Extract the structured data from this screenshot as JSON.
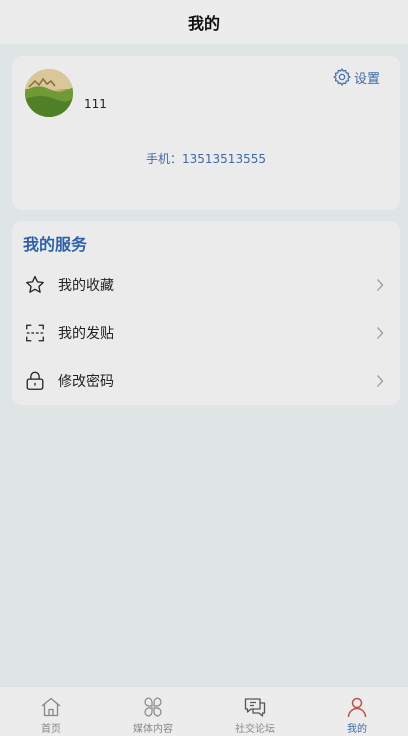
{
  "header": {
    "title": "我的"
  },
  "profile": {
    "username": "111",
    "settings_label": "设置",
    "settings_icon": "gear-icon",
    "phone_text": "手机：13513513555"
  },
  "services": {
    "title": "我的服务",
    "items": [
      {
        "label": "我的收藏",
        "icon": "star-icon"
      },
      {
        "label": "我的发贴",
        "icon": "scan-icon"
      },
      {
        "label": "修改密码",
        "icon": "lock-icon"
      }
    ]
  },
  "tabbar": {
    "tabs": [
      {
        "label": "首页",
        "icon": "home-icon"
      },
      {
        "label": "媒体内容",
        "icon": "grid-icon"
      },
      {
        "label": "社交论坛",
        "icon": "chat-icon"
      },
      {
        "label": "我的",
        "icon": "person-icon"
      }
    ],
    "active_index": 3
  },
  "colors": {
    "accent": "#3f6aa6",
    "active_tab_icon": "#c0504d",
    "background": "#dfe4e4",
    "card": "#ebebec"
  }
}
